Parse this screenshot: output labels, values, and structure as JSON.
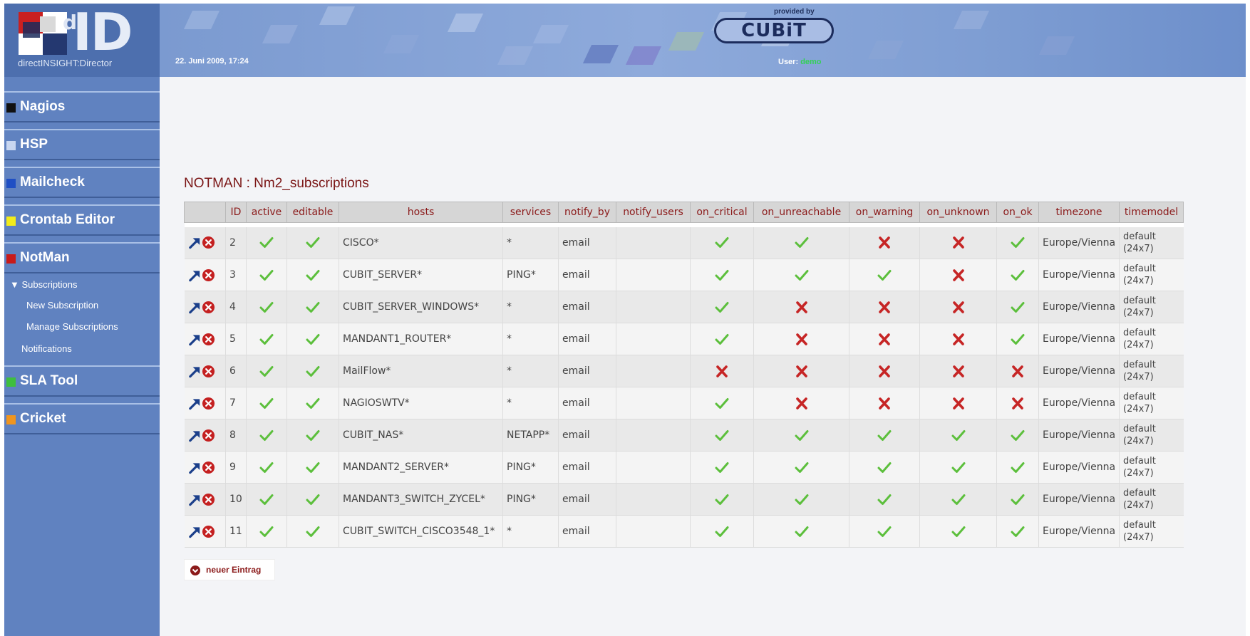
{
  "header": {
    "logo_letters": "ID",
    "logo_small": "d",
    "logo_subtitle": "directINSIGHT:Director",
    "datetime": "22. Juni 2009, 17:24",
    "provided_by": "provided by",
    "brand": "CUBiT",
    "user_label": "User:",
    "user_name": "demo"
  },
  "sidebar": {
    "items": [
      {
        "label": "Nagios",
        "color": "#111111"
      },
      {
        "label": "HSP",
        "color": "#c8d6f0"
      },
      {
        "label": "Mailcheck",
        "color": "#1f4fc4"
      },
      {
        "label": "Crontab Editor",
        "color": "#f2ec1a"
      },
      {
        "label": "NotMan",
        "color": "#c81a1a"
      },
      {
        "label": "SLA Tool",
        "color": "#3ebf3e"
      },
      {
        "label": "Cricket",
        "color": "#f0951e"
      }
    ],
    "notman_sub": {
      "subscriptions": "▼ Subscriptions",
      "new_subscription": "New Subscription",
      "manage_subscriptions": "Manage Subscriptions",
      "notifications": "Notifications"
    }
  },
  "main": {
    "title": "NOTMAN : Nm2_subscriptions",
    "columns": [
      "",
      "ID",
      "active",
      "editable",
      "hosts",
      "services",
      "notify_by",
      "notify_users",
      "on_critical",
      "on_unreachable",
      "on_warning",
      "on_unknown",
      "on_ok",
      "timezone",
      "timemodel"
    ],
    "rows": [
      {
        "id": "2",
        "host": "CISCO*",
        "services": "*",
        "notify_by": "email",
        "notify_users": "",
        "flags": [
          true,
          true,
          true,
          true,
          false,
          false,
          true
        ],
        "timezone": "Europe/Vienna",
        "tm1": "default",
        "tm2": "(24x7)"
      },
      {
        "id": "3",
        "host": "CUBIT_SERVER*",
        "services": "PING*",
        "notify_by": "email",
        "notify_users": "",
        "flags": [
          true,
          true,
          true,
          true,
          true,
          false,
          true
        ],
        "timezone": "Europe/Vienna",
        "tm1": "default",
        "tm2": "(24x7)"
      },
      {
        "id": "4",
        "host": "CUBIT_SERVER_WINDOWS*",
        "services": "*",
        "notify_by": "email",
        "notify_users": "",
        "flags": [
          true,
          true,
          true,
          false,
          false,
          false,
          true
        ],
        "timezone": "Europe/Vienna",
        "tm1": "default",
        "tm2": "(24x7)"
      },
      {
        "id": "5",
        "host": "MANDANT1_ROUTER*",
        "services": "*",
        "notify_by": "email",
        "notify_users": "",
        "flags": [
          true,
          true,
          true,
          false,
          false,
          false,
          true
        ],
        "timezone": "Europe/Vienna",
        "tm1": "default",
        "tm2": "(24x7)"
      },
      {
        "id": "6",
        "host": "MailFlow*",
        "services": "*",
        "notify_by": "email",
        "notify_users": "",
        "flags": [
          true,
          true,
          false,
          false,
          false,
          false,
          false
        ],
        "timezone": "Europe/Vienna",
        "tm1": "default",
        "tm2": "(24x7)"
      },
      {
        "id": "7",
        "host": "NAGIOSWTV*",
        "services": "*",
        "notify_by": "email",
        "notify_users": "",
        "flags": [
          true,
          true,
          true,
          false,
          false,
          false,
          false
        ],
        "timezone": "Europe/Vienna",
        "tm1": "default",
        "tm2": "(24x7)"
      },
      {
        "id": "8",
        "host": "CUBIT_NAS*",
        "services": "NETAPP*",
        "notify_by": "email",
        "notify_users": "",
        "flags": [
          true,
          true,
          true,
          true,
          true,
          true,
          true
        ],
        "timezone": "Europe/Vienna",
        "tm1": "default",
        "tm2": "(24x7)"
      },
      {
        "id": "9",
        "host": "MANDANT2_SERVER*",
        "services": "PING*",
        "notify_by": "email",
        "notify_users": "",
        "flags": [
          true,
          true,
          true,
          true,
          true,
          true,
          true
        ],
        "timezone": "Europe/Vienna",
        "tm1": "default",
        "tm2": "(24x7)"
      },
      {
        "id": "10",
        "host": "MANDANT3_SWITCH_ZYCEL*",
        "services": "PING*",
        "notify_by": "email",
        "notify_users": "",
        "flags": [
          true,
          true,
          true,
          true,
          true,
          true,
          true
        ],
        "timezone": "Europe/Vienna",
        "tm1": "default",
        "tm2": "(24x7)"
      },
      {
        "id": "11",
        "host": "CUBIT_SWITCH_CISCO3548_1*",
        "services": "*",
        "notify_by": "email",
        "notify_users": "",
        "flags": [
          true,
          true,
          true,
          true,
          true,
          true,
          true
        ],
        "timezone": "Europe/Vienna",
        "tm1": "default",
        "tm2": "(24x7)"
      }
    ],
    "new_entry_label": "neuer Eintrag"
  },
  "colors": {
    "accent": "#8b1a1a",
    "check": "#5cbf3c",
    "cross": "#c62525",
    "edit_arrow": "#1b3f8a"
  },
  "icons": {
    "edit": "arrow-up-right-icon",
    "delete": "circle-x-icon",
    "yes": "check-icon",
    "no": "cross-icon",
    "new": "chevron-down-circle-icon"
  }
}
